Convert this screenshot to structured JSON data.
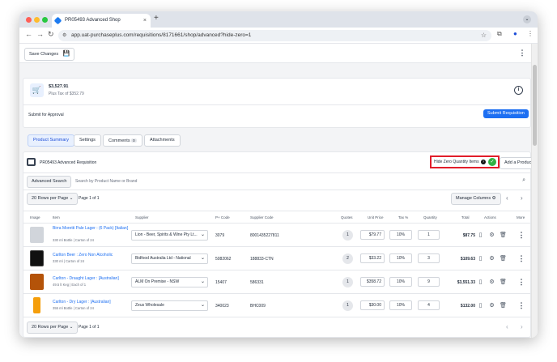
{
  "browser": {
    "tab_title": "PR05493 Advanced Shop",
    "tab_close": "×",
    "new_tab": "+",
    "url": "app.uat-purchaseplus.com/requisitions/8171661/shop/advanced?hide-zero=1",
    "colors": {
      "close": "#ff5f57",
      "minimize": "#febc2e",
      "maximize": "#28c840"
    }
  },
  "toolbar": {
    "save_label": "Save Changes"
  },
  "summary": {
    "total": "$3,527.91",
    "tax": "Plus Tax of $352.79",
    "submit_for_approval": "Submit for Approval",
    "submit_button": "Submit Requisition"
  },
  "tabs": [
    {
      "label": "Product Summary"
    },
    {
      "label": "Settings"
    },
    {
      "label": "Comments",
      "count": "0"
    },
    {
      "label": "Attachments"
    }
  ],
  "requisition": {
    "title": "PR05493 Advanced Requisition",
    "hide_zero_label": "Hide Zero Quantity Items",
    "add_product": "Add a Product",
    "highlight_color": "#e11d2a"
  },
  "search": {
    "advanced_label": "Advanced Search",
    "placeholder": "Search by Product Name or Brand"
  },
  "pagination": {
    "rows_per_page": "20 Rows per Page",
    "page_info": "Page 1 of 1",
    "manage_columns": "Manage Columns"
  },
  "table": {
    "headers": [
      "Image",
      "Item",
      "Supplier",
      "P+ Code",
      "Supplier Code",
      "Quotes",
      "Unit Price",
      "Tax %",
      "Quantity",
      "Total",
      "Actions",
      "More"
    ],
    "rows": [
      {
        "name": "Birra Moretti Pale Lager : (6 Pack) [Italian]",
        "detail": "330 ml Bottle | Carton of 24",
        "supplier": "Lion - Beer, Spirits & Wine Pty Lt...",
        "pcode": "3079",
        "supplier_code": "8001435227811",
        "quotes": "1",
        "unit_price": "$79.77",
        "tax": "10%",
        "quantity": "1",
        "total": "$87.75"
      },
      {
        "name": "Carlton Beer : Zero Non Alcoholic",
        "detail": "330 ml | Carton of 24",
        "supplier": "Bidfood Australia Ltd - National",
        "pcode": "5082062",
        "supplier_code": "188833-CTN",
        "quotes": "2",
        "unit_price": "$33.22",
        "tax": "10%",
        "quantity": "3",
        "total": "$109.63"
      },
      {
        "name": "Carlton - Draught Lager : [Australian]",
        "detail": "49.5 lt Keg | Each of 1",
        "supplier": "ALM On Premise - NSW",
        "pcode": "15407",
        "supplier_code": "586331",
        "quotes": "1",
        "unit_price": "$358.72",
        "tax": "10%",
        "quantity": "9",
        "total": "$3,551.33"
      },
      {
        "name": "Carlton - Dry Lager : [Australian]",
        "detail": "355 ml Bottle | Carton of 24",
        "supplier": "Zeus Wholesale",
        "pcode": "340023",
        "supplier_code": "BHC009",
        "quotes": "1",
        "unit_price": "$30.00",
        "tax": "10%",
        "quantity": "4",
        "total": "$132.00"
      }
    ]
  },
  "icons": [
    "cart-icon",
    "info-icon",
    "save-icon",
    "check-circle-icon",
    "gear-icon",
    "trash-icon",
    "document-icon",
    "chevron-left-icon",
    "chevron-right-icon",
    "search-icon",
    "kebab-icon"
  ]
}
